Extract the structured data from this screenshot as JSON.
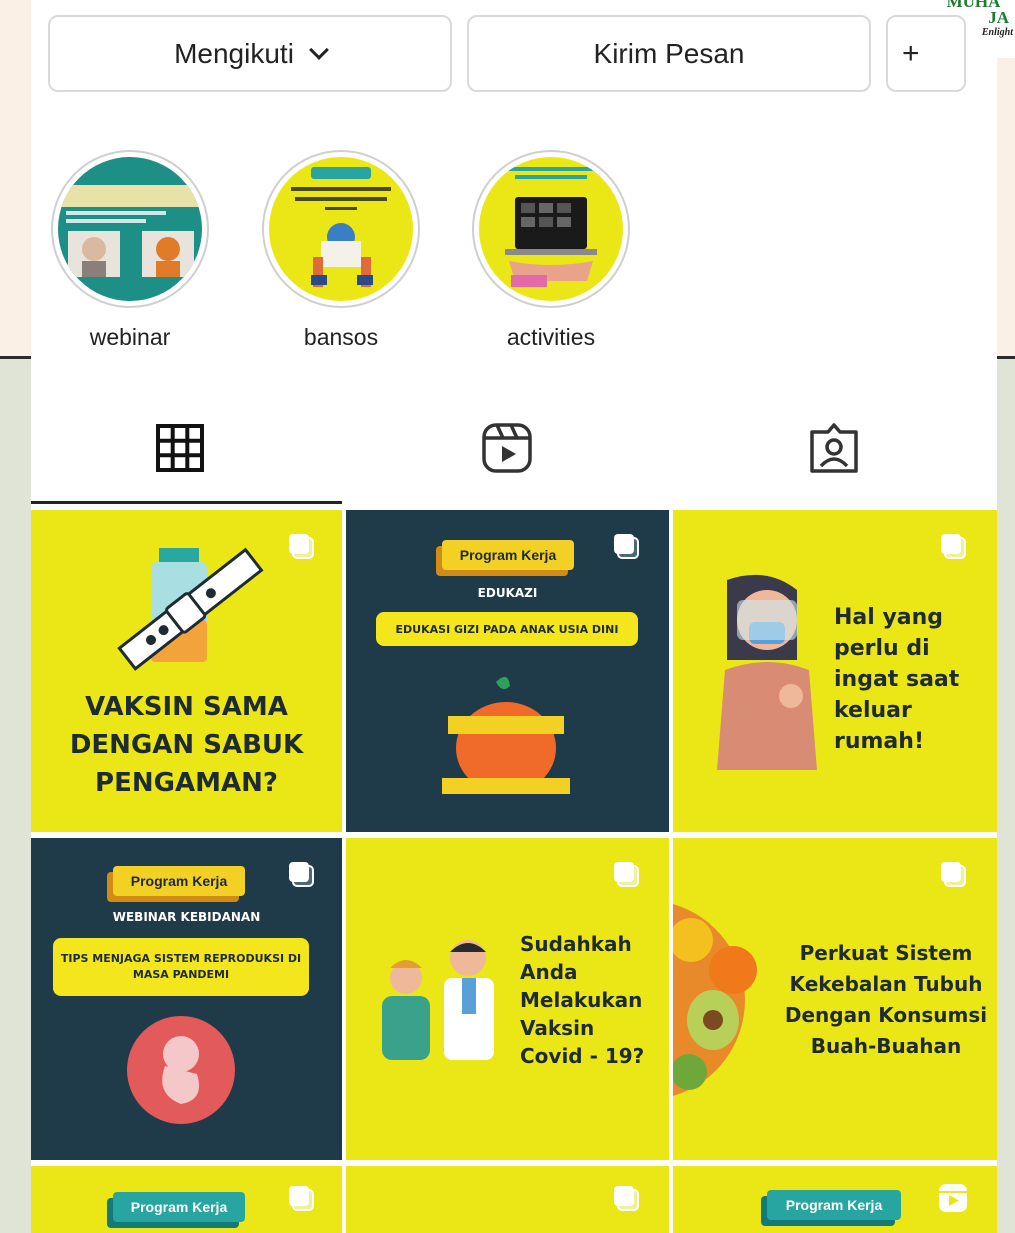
{
  "logo": {
    "line1": "MUHA",
    "line2": "JA",
    "line3": "Enlight"
  },
  "actions": {
    "follow_label": "Mengikuti",
    "message_label": "Kirim Pesan",
    "add_label": "+"
  },
  "highlights": [
    {
      "label": "webinar"
    },
    {
      "label": "bansos"
    },
    {
      "label": "activities"
    }
  ],
  "tabs": [
    {
      "name": "posts",
      "icon": "grid-icon",
      "active": true
    },
    {
      "name": "reels",
      "icon": "reels-icon",
      "active": false
    },
    {
      "name": "tagged",
      "icon": "tagged-icon",
      "active": false
    }
  ],
  "posts": [
    {
      "text": "VAKSIN SAMA DENGAN SABUK PENGAMAN?"
    },
    {
      "badge": "Program Kerja",
      "subtitle": "EDUKAZI",
      "banner": "EDUKASI GIZI PADA ANAK USIA DINI"
    },
    {
      "text": "Hal yang perlu di ingat saat keluar rumah!"
    },
    {
      "badge": "Program Kerja",
      "subtitle": "WEBINAR KEBIDANAN",
      "banner": "TIPS MENJAGA SISTEM REPRODUKSI DI MASA PANDEMI"
    },
    {
      "text": "Sudahkah Anda Melakukan Vaksin Covid - 19?"
    },
    {
      "text": "Perkuat Sistem Kekebalan Tubuh Dengan Konsumsi Buah-Buahan"
    },
    {
      "badge": "Program Kerja"
    },
    {},
    {
      "badge": "Program Kerja"
    }
  ],
  "colors": {
    "yellow": "#ebe717",
    "navy": "#1f3a48",
    "teal": "#27a6a1"
  }
}
